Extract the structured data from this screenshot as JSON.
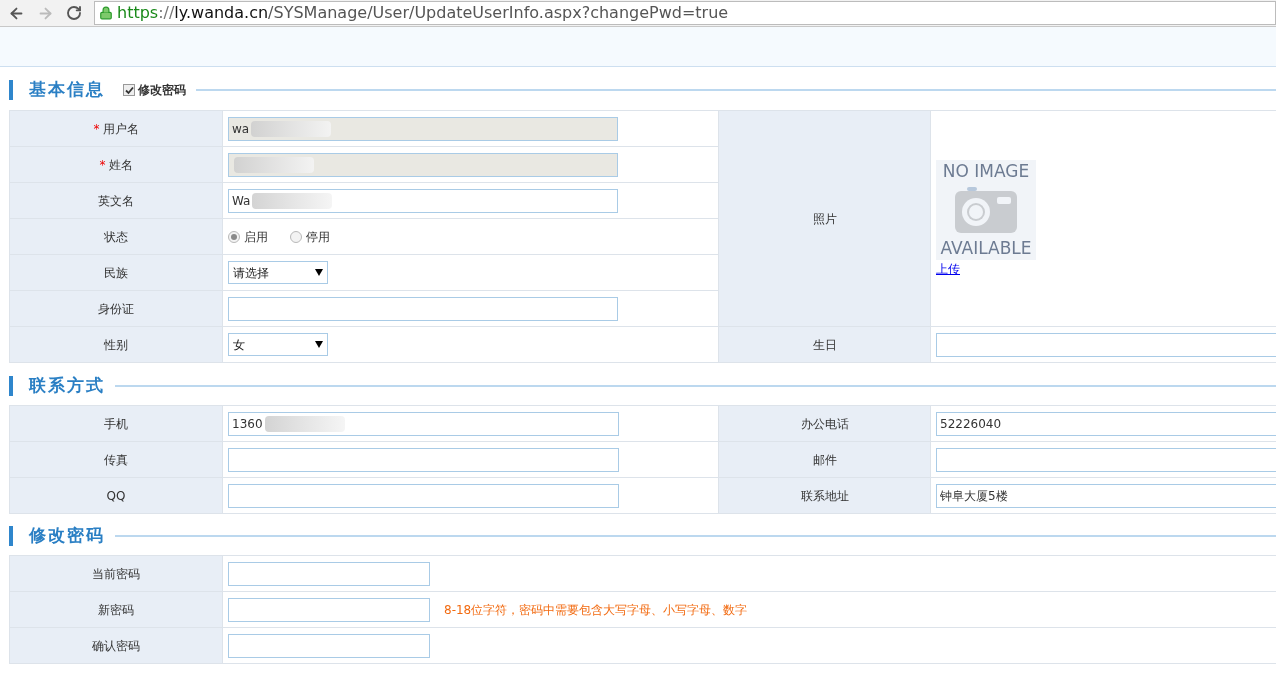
{
  "browser": {
    "forward_disabled": true,
    "url": [
      {
        "kind": "scheme",
        "text": "https"
      },
      {
        "kind": "punct",
        "text": "://"
      },
      {
        "kind": "host",
        "text": "ly.wanda.cn"
      },
      {
        "kind": "path",
        "text": "/SYSManage/User/UpdateUserInfo.aspx?changePwd=true"
      }
    ]
  },
  "basic_info": {
    "title": "基本信息",
    "required_mark": "*",
    "toggle": {
      "label": "修改密码",
      "checked": true
    },
    "fields": [
      {
        "label": "用户名",
        "required": true,
        "kind": "text",
        "value": "wa",
        "readonly": true,
        "blurred": true
      },
      {
        "label": "姓名",
        "required": true,
        "kind": "text",
        "readonly": true,
        "blurred": true
      },
      {
        "label": "英文名",
        "required": false,
        "kind": "text",
        "value": "Wa",
        "readonly": false,
        "blurred": true
      },
      {
        "label": "状态",
        "required": false,
        "kind": "radio",
        "options": [
          {
            "label": "启用",
            "selected": true
          },
          {
            "label": "停用",
            "selected": false
          }
        ]
      },
      {
        "label": "民族",
        "required": false,
        "kind": "select",
        "value": "请选择"
      },
      {
        "label": "身份证",
        "required": false,
        "kind": "text",
        "readonly": false,
        "blurred": false
      },
      {
        "label": "性别",
        "required": false,
        "kind": "select",
        "value": "女"
      }
    ],
    "photo": {
      "label": "照片",
      "image_top": "NO IMAGE",
      "image_bottom": "AVAILABLE",
      "upload_link": "上传"
    },
    "birthday": {
      "label": "生日"
    }
  },
  "contact": {
    "title": "联系方式",
    "rows": [
      [
        {
          "label": "手机",
          "value": "1360",
          "blurred": true
        },
        {
          "label": "办公电话",
          "value": "52226040",
          "blurred": false
        }
      ],
      [
        {
          "label": "传真",
          "blurred": false
        },
        {
          "label": "邮件",
          "blurred": false
        }
      ],
      [
        {
          "label": "QQ",
          "blurred": false
        },
        {
          "label": "联系地址",
          "value": "钟阜大厦5楼",
          "blurred": false
        }
      ]
    ]
  },
  "change_password": {
    "title": "修改密码",
    "rows": [
      {
        "label": "当前密码"
      },
      {
        "label": "新密码",
        "hint": "8-18位字符，密码中需要包含大写字母、小写字母、数字"
      },
      {
        "label": "确认密码"
      }
    ]
  }
}
